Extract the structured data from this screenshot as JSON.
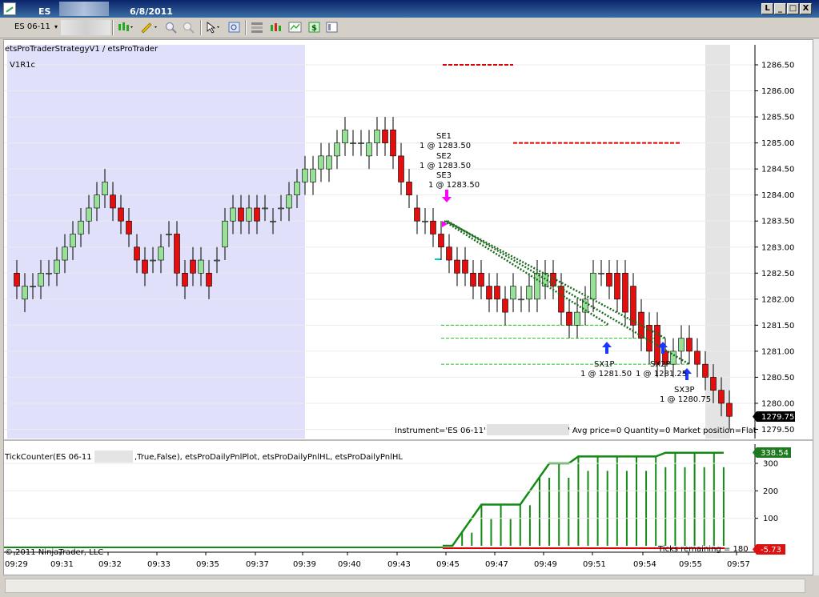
{
  "window": {
    "instrument": "ES 06-11",
    "date": "6/8/2011",
    "buttons": [
      "L",
      "_",
      "□",
      "X"
    ]
  },
  "toolbar": {
    "instrument": "ES 06-11"
  },
  "main_chart": {
    "strategy_label": "etsProTraderStrategyV1 / etsProTrader",
    "version_label": "V1R1c",
    "y_ticks": [
      "1286.50",
      "1286.00",
      "1285.50",
      "1285.00",
      "1284.50",
      "1284.00",
      "1283.50",
      "1283.00",
      "1282.50",
      "1282.00",
      "1281.50",
      "1281.00",
      "1280.50",
      "1280.00",
      "1279.50"
    ],
    "last_price": "1279.75",
    "status_line_start": "Instrument='ES 06-11' A",
    "status_line_end": "' Avg price=0 Quantity=0 Market position=Flat",
    "entries": [
      {
        "name": "SE1",
        "detail": "1 @ 1283.50"
      },
      {
        "name": "SE2",
        "detail": "1 @ 1283.50"
      },
      {
        "name": "SE3",
        "detail": "1 @ 1283.50"
      }
    ],
    "exits": [
      {
        "name": "SX1P",
        "detail": "1 @ 1281.50"
      },
      {
        "name": "SX2P",
        "detail": "1 @ 1281.25"
      },
      {
        "name": "SX3P",
        "detail": "1 @ 1280.75"
      }
    ]
  },
  "indicator_panel": {
    "label_start": "TickCounter(ES  06-11",
    "label_end": ",True,False),  etsProDailyPnlPlot,  etsProDailyPnlHL,  etsProDailyPnlHL",
    "y_ticks": [
      "300",
      "200",
      "100"
    ],
    "value_high": "338.54",
    "value_low": "-5.73",
    "copyright": "© 2011 NinjaTrader, LLC",
    "ticks_remaining": "Ticks remaining = 180"
  },
  "x_axis": {
    "ticks": [
      "09:29",
      "09:31",
      "09:32",
      "09:33",
      "09:35",
      "09:37",
      "09:39",
      "09:40",
      "09:43",
      "09:45",
      "09:47",
      "09:49",
      "09:51",
      "09:54",
      "09:55",
      "09:57"
    ]
  },
  "colors": {
    "up_candle": "#98e098",
    "down_candle": "#e01010",
    "session_shade": "#e0e0fa",
    "gray_shade": "#e4e4e4",
    "pnl_green": "#138a13",
    "pnl_red": "#e00000",
    "dotted_trade": "#1d6b1d",
    "target_red": "#e00000",
    "stop_green": "#22c022",
    "entry_marker": "#ff00ff",
    "exit_marker": "#1a37ff",
    "last_price_bg": "#000000",
    "pnl_badge_bg": "#1e7a1e",
    "loss_badge_bg": "#dd1111"
  },
  "chart_data": {
    "type": "candlestick",
    "x": [
      "09:29",
      "09:29",
      "09:30",
      "09:30",
      "09:31",
      "09:31",
      "09:31",
      "09:31",
      "09:32",
      "09:32",
      "09:32",
      "09:32",
      "09:32",
      "09:33",
      "09:33",
      "09:33",
      "09:33",
      "09:34",
      "09:34",
      "09:34",
      "09:35",
      "09:35",
      "09:35",
      "09:36",
      "09:36",
      "09:36",
      "09:37",
      "09:37",
      "09:37",
      "09:38",
      "09:38",
      "09:38",
      "09:39",
      "09:39",
      "09:39",
      "09:40",
      "09:40",
      "09:40",
      "09:41",
      "09:41",
      "09:41",
      "09:42",
      "09:42",
      "09:43",
      "09:43",
      "09:43",
      "09:44",
      "09:44",
      "09:44",
      "09:45",
      "09:45",
      "09:45",
      "09:46",
      "09:46",
      "09:46",
      "09:47",
      "09:47",
      "09:47",
      "09:48",
      "09:48",
      "09:48",
      "09:49",
      "09:49",
      "09:49",
      "09:50",
      "09:50",
      "09:50",
      "09:51",
      "09:51",
      "09:51",
      "09:52",
      "09:52",
      "09:52",
      "09:53",
      "09:53",
      "09:53",
      "09:54",
      "09:54",
      "09:54",
      "09:55",
      "09:55",
      "09:55",
      "09:56",
      "09:56",
      "09:56",
      "09:57",
      "09:57",
      "09:57",
      "09:57",
      "09:57"
    ],
    "open": [
      1282.5,
      1282.0,
      1282.25,
      1282.25,
      1282.5,
      1282.5,
      1282.75,
      1283.0,
      1283.25,
      1283.5,
      1283.75,
      1284.0,
      1284.0,
      1283.75,
      1283.5,
      1283.0,
      1282.75,
      1282.75,
      1282.75,
      1283.25,
      1283.25,
      1282.5,
      1282.75,
      1282.5,
      1282.5,
      1282.75,
      1283.0,
      1283.5,
      1283.75,
      1283.5,
      1283.75,
      1283.75,
      1283.5,
      1283.75,
      1283.75,
      1284.0,
      1284.25,
      1284.25,
      1284.5,
      1284.5,
      1284.75,
      1285.0,
      1285.0,
      1285.0,
      1284.75,
      1285.0,
      1285.25,
      1285.25,
      1284.75,
      1284.25,
      1283.75,
      1283.5,
      1283.5,
      1283.25,
      1283.0,
      1282.75,
      1282.75,
      1282.5,
      1282.5,
      1282.25,
      1282.25,
      1282.0,
      1282.0,
      1282.0,
      1282.0,
      1282.0,
      1282.25,
      1282.5,
      1282.25,
      1281.75,
      1281.5,
      1281.75,
      1282.0,
      1282.5,
      1282.5,
      1282.5,
      1282.5,
      1282.25,
      1281.75,
      1281.5,
      1281.5,
      1281.0,
      1280.75,
      1281.0,
      1281.25,
      1281.0,
      1280.75,
      1280.5,
      1280.25,
      1280.0
    ],
    "close": [
      1282.25,
      1282.25,
      1282.25,
      1282.5,
      1282.5,
      1282.75,
      1283.0,
      1283.25,
      1283.5,
      1283.75,
      1284.0,
      1284.25,
      1283.75,
      1283.5,
      1283.25,
      1282.75,
      1282.5,
      1282.75,
      1283.0,
      1283.25,
      1282.5,
      1282.25,
      1282.5,
      1282.75,
      1282.25,
      1282.75,
      1283.5,
      1283.75,
      1283.5,
      1283.75,
      1283.5,
      1283.75,
      1283.5,
      1283.75,
      1284.0,
      1284.25,
      1284.5,
      1284.5,
      1284.75,
      1284.75,
      1285.0,
      1285.25,
      1285.0,
      1285.0,
      1285.0,
      1285.25,
      1285.0,
      1284.75,
      1284.25,
      1284.0,
      1283.5,
      1283.5,
      1283.25,
      1283.0,
      1282.75,
      1282.5,
      1282.5,
      1282.25,
      1282.25,
      1282.0,
      1282.0,
      1281.75,
      1282.25,
      1282.0,
      1282.25,
      1282.5,
      1282.5,
      1282.25,
      1281.75,
      1281.5,
      1281.75,
      1282.0,
      1282.5,
      1282.5,
      1282.25,
      1282.0,
      1281.75,
      1281.5,
      1281.25,
      1281.0,
      1280.75,
      1280.75,
      1281.0,
      1281.25,
      1281.0,
      1280.75,
      1280.5,
      1280.25,
      1280.0,
      1279.75
    ],
    "target_lines": [
      1285.0,
      1286.5
    ],
    "stop_lines": [
      1281.5,
      1281.25,
      1280.75
    ],
    "ylim": [
      1279.25,
      1286.75
    ],
    "pnl": {
      "x_from": "09:45",
      "values": [
        0,
        0,
        50,
        100,
        150,
        150,
        150,
        150,
        150,
        200,
        250,
        300,
        300,
        300,
        325,
        325,
        325,
        325,
        325,
        325,
        325,
        325,
        325,
        338.54,
        338.54,
        338.54,
        338.54,
        338.54,
        338.54,
        338.54
      ],
      "ylim": [
        -20,
        360
      ],
      "baseline": -5.73
    }
  }
}
